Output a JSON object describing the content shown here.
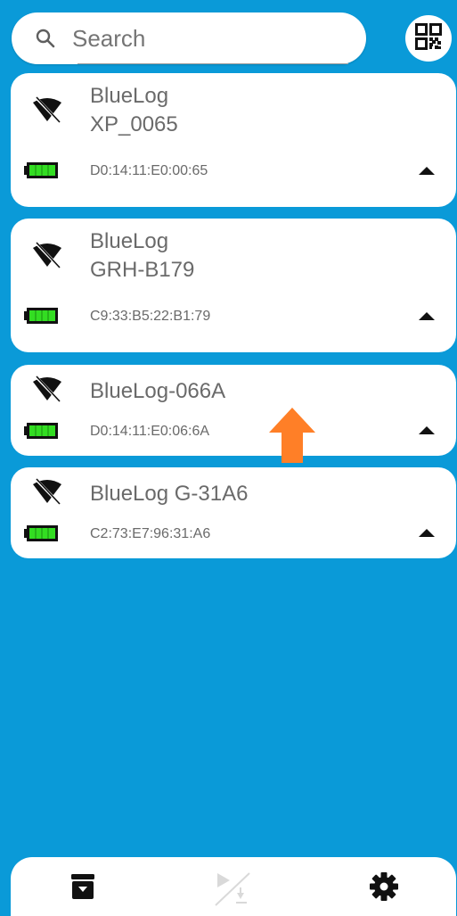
{
  "search": {
    "placeholder": "Search"
  },
  "devices": [
    {
      "name_line1": "BlueLog",
      "name_line2": "XP_0065",
      "mac": "D0:14:11:E0:00:65",
      "wifi": "wifi-off-icon",
      "battery": "battery-full-icon",
      "expand": "expand-up-icon"
    },
    {
      "name_line1": "BlueLog",
      "name_line2": "GRH-B179",
      "mac": "C9:33:B5:22:B1:79",
      "wifi": "wifi-off-icon",
      "battery": "battery-full-icon",
      "expand": "expand-up-icon"
    },
    {
      "name_line1": "BlueLog-066A",
      "mac": "D0:14:11:E0:06:6A",
      "wifi": "wifi-off-icon",
      "battery": "battery-full-icon",
      "expand": "expand-up-icon"
    },
    {
      "name_line1": "BlueLog G-31A6",
      "mac": "C2:73:E7:96:31:A6",
      "wifi": "wifi-off-icon",
      "battery": "battery-full-icon",
      "expand": "expand-up-icon"
    }
  ],
  "bottom_bar": {
    "items": [
      {
        "icon": "archive-icon",
        "enabled": true
      },
      {
        "icon": "play-download-icon",
        "enabled": false
      },
      {
        "icon": "gear-icon",
        "enabled": true
      }
    ]
  },
  "colors": {
    "background": "#0a9ad8",
    "card": "#ffffff",
    "text": "#6a6a6a",
    "battery": "#33dd22",
    "arrow": "#ff7f27"
  }
}
